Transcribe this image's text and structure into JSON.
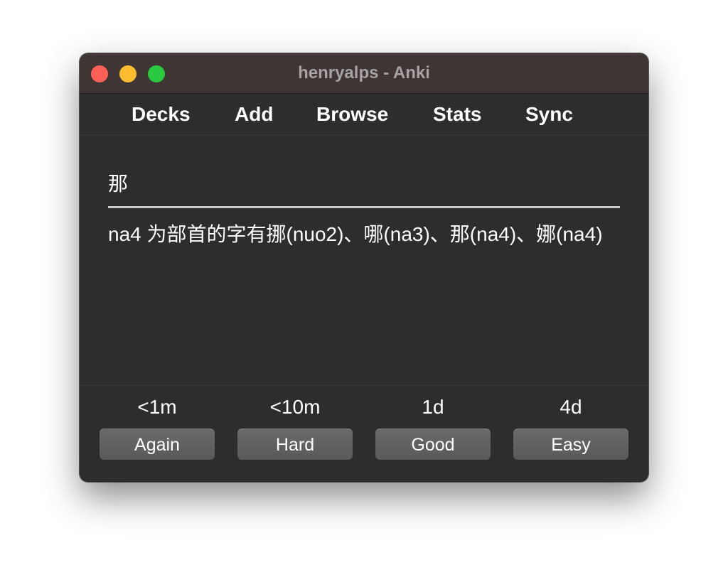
{
  "window": {
    "title": "henryalps - Anki"
  },
  "toolbar": {
    "items": [
      {
        "label": "Decks"
      },
      {
        "label": "Add"
      },
      {
        "label": "Browse"
      },
      {
        "label": "Stats"
      },
      {
        "label": "Sync"
      }
    ]
  },
  "card": {
    "front": "那",
    "back": "na4 为部首的字有挪(nuo2)、哪(na3)、那(na4)、娜(na4)"
  },
  "answer_buttons": [
    {
      "interval": "<1m",
      "label": "Again"
    },
    {
      "interval": "<10m",
      "label": "Hard"
    },
    {
      "interval": "1d",
      "label": "Good"
    },
    {
      "interval": "4d",
      "label": "Easy"
    }
  ],
  "colors": {
    "close": "#fe5f57",
    "minimize": "#febc2e",
    "maximize": "#28c840",
    "background": "#2d2d2f",
    "titlebar": "#3f3535"
  }
}
